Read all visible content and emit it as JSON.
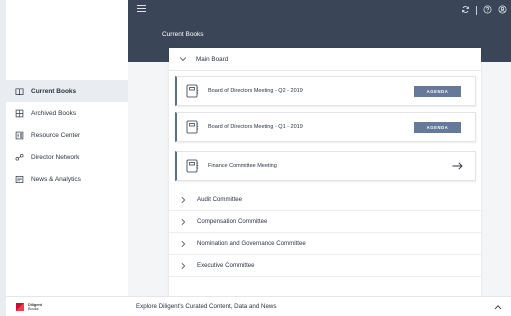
{
  "topbar": {
    "icons": [
      "menu-icon",
      "sync-icon",
      "help-icon",
      "user-icon"
    ]
  },
  "header": {
    "title": "Current Books"
  },
  "sidebar": {
    "items": [
      {
        "label": "Current Books",
        "icon": "book-open-icon",
        "active": true
      },
      {
        "label": "Archived Books",
        "icon": "archive-icon",
        "active": false
      },
      {
        "label": "Resource Center",
        "icon": "resource-icon",
        "active": false
      },
      {
        "label": "Director Network",
        "icon": "network-icon",
        "active": false
      },
      {
        "label": "News & Analytics",
        "icon": "news-icon",
        "active": false
      }
    ],
    "brand": {
      "name": "Diligent",
      "sub": "Books"
    }
  },
  "main": {
    "section_title": "Main Board",
    "meetings": [
      {
        "title": "Board of Directors Meeting - Q2 - 2019",
        "action": "AGENDA"
      },
      {
        "title": "Board of Directors Meeting - Q1 - 2019",
        "action": "AGENDA"
      },
      {
        "title": "Finance Committee Meeting",
        "action": "arrow-right-icon"
      }
    ],
    "committees": [
      "Audit Committee",
      "Compensation Committee",
      "Nomination and Governance Committee",
      "Executive Committee"
    ]
  },
  "bottombar": {
    "text": "Explore Diligent's Curated Content, Data and News"
  },
  "colors": {
    "header_bg": "#3a4658",
    "agenda_button": "#67799a",
    "card_accent": "#5f6f86",
    "active_nav_bg": "#e9ecf0",
    "brand_red": "#c8102e"
  }
}
